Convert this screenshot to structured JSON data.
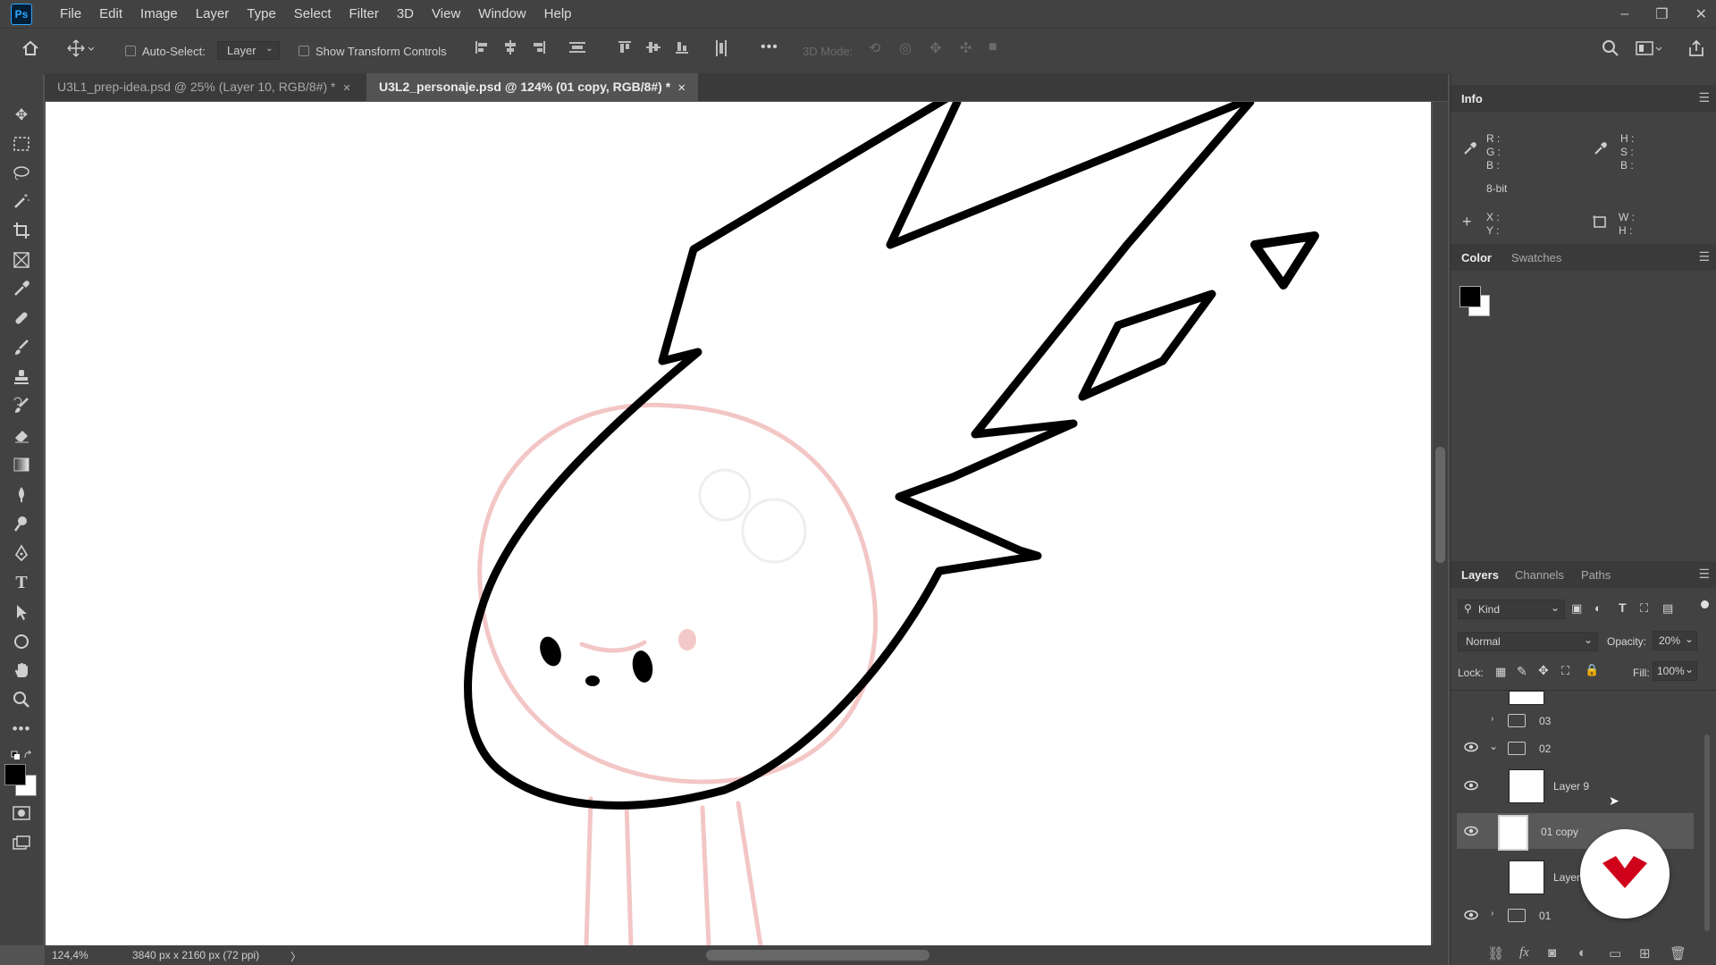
{
  "app": {
    "logo_text": "Ps"
  },
  "menu": [
    "File",
    "Edit",
    "Image",
    "Layer",
    "Type",
    "Select",
    "Filter",
    "3D",
    "View",
    "Window",
    "Help"
  ],
  "window_controls": {
    "minimize": "–",
    "restore": "❐",
    "close": "✕"
  },
  "options": {
    "auto_select_label": "Auto-Select:",
    "auto_select_value": "Layer",
    "show_transform_label": "Show Transform Controls",
    "mode_3d_label": "3D Mode:",
    "more": "•••"
  },
  "tabs": [
    {
      "label": "U3L1_prep-idea.psd @ 25% (Layer 10, RGB/8#) *",
      "close": "✕"
    },
    {
      "label": "U3L2_personaje.psd @ 124% (01 copy, RGB/8#) *",
      "close": "✕"
    }
  ],
  "status": {
    "zoom": "124,4%",
    "doc_size": "3840 px x 2160 px (72 ppi)",
    "arrow": "〉"
  },
  "info_panel": {
    "title": "Info",
    "rgb": [
      "R :",
      "G :",
      "B :"
    ],
    "hsb": [
      "H :",
      "S :",
      "B :"
    ],
    "bitdepth": "8-bit",
    "xy": [
      "X :",
      "Y :"
    ],
    "wh": [
      "W :",
      "H :"
    ]
  },
  "color_panel": {
    "tabs": [
      "Color",
      "Swatches"
    ],
    "fg": "#000000",
    "bg": "#ffffff"
  },
  "layers_panel": {
    "tabs": [
      "Layers",
      "Channels",
      "Paths"
    ],
    "filter_kind": "Kind",
    "blend_mode": "Normal",
    "opacity_label": "Opacity:",
    "opacity_value": "20%",
    "lock_label": "Lock:",
    "fill_label": "Fill:",
    "fill_value": "100%",
    "layers": [
      {
        "name": "03",
        "type": "group",
        "visible": false,
        "expanded": false
      },
      {
        "name": "02",
        "type": "group",
        "visible": true,
        "expanded": true
      },
      {
        "name": "Layer 9",
        "type": "layer",
        "visible": true
      },
      {
        "name": "01 copy",
        "type": "layer",
        "visible": true,
        "selected": true
      },
      {
        "name": "Layer",
        "type": "layer",
        "visible": false
      },
      {
        "name": "01",
        "type": "group",
        "visible": true,
        "expanded": false
      }
    ],
    "fx_label": "fx"
  }
}
